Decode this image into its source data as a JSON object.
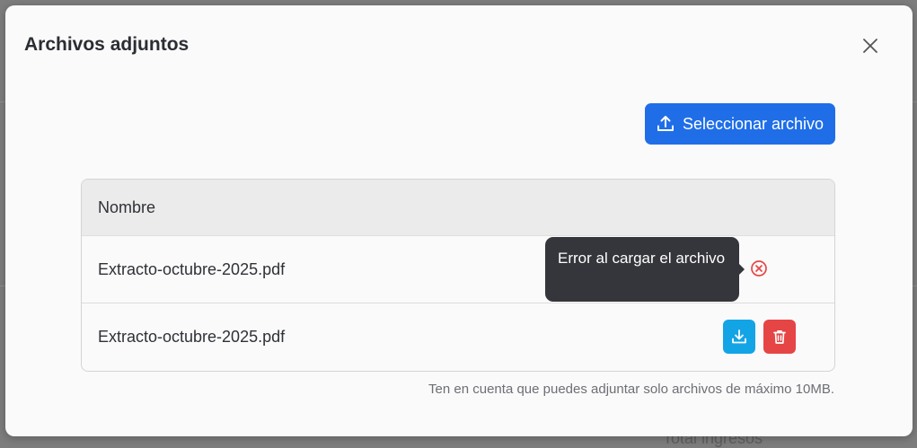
{
  "modal": {
    "title": "Archivos adjuntos",
    "close_icon": "close-icon"
  },
  "upload": {
    "label": "Seleccionar archivo",
    "icon": "upload-icon",
    "color": "#1f6ee8"
  },
  "table": {
    "column_header": "Nombre",
    "rows": [
      {
        "file_name": "Extracto-octubre-2025.pdf",
        "status": "error",
        "tooltip": "Error al cargar el archivo",
        "icon": "error-circle-icon"
      },
      {
        "file_name": "Extracto-octubre-2025.pdf",
        "status": "uploaded",
        "actions": [
          "download-icon",
          "trash-icon"
        ]
      }
    ]
  },
  "note": "Ten en cuenta que puedes adjuntar solo archivos de máximo 10MB.",
  "colors": {
    "error": "#e64545",
    "download": "#13a4e6",
    "tooltip_bg": "#35363b"
  }
}
